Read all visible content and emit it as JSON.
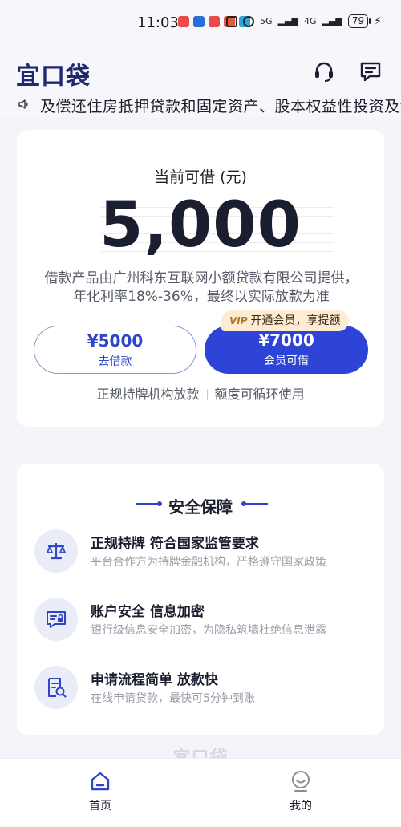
{
  "status_bar": {
    "time": "11:03",
    "network": "5G",
    "network2": "4G",
    "battery": "79"
  },
  "header": {
    "logo": "宜口袋",
    "icons": [
      "headset-icon",
      "message-icon"
    ]
  },
  "notice": {
    "text": "及偿还住房抵押贷款和固定资产、股本权益性投资及流动资金"
  },
  "loan": {
    "title": "当前可借 (元)",
    "amount": "5,000",
    "description": "借款产品由广州科东互联网小额贷款有限公司提供，年化利率18%-36%，最终以实际放款为准",
    "borrow_button": {
      "amount": "¥5000",
      "label": "去借款"
    },
    "member_button": {
      "amount": "¥7000",
      "label": "会员可借"
    },
    "vip_tag": {
      "badge": "VIP",
      "text": "开通会员，享提额"
    },
    "features": [
      "正规持牌机构放款",
      "额度可循环使用"
    ]
  },
  "security": {
    "title": "安全保障",
    "items": [
      {
        "icon": "scale-icon",
        "title": "正规持牌 符合国家监管要求",
        "desc": "平台合作方为持牌金融机构，严格遵守国家政策"
      },
      {
        "icon": "account-lock-icon",
        "title": "账户安全 信息加密",
        "desc": "银行级信息安全加密，为隐私筑墙杜绝信息泄露"
      },
      {
        "icon": "document-search-icon",
        "title": "申请流程简单 放款快",
        "desc": "在线申请贷款，最快可5分钟到账"
      }
    ]
  },
  "footer_logo": "宜口袋",
  "tabbar": {
    "home": "首页",
    "mine": "我的"
  },
  "colors": {
    "primary": "#2e44d6",
    "brand_dark": "#1f2a6e",
    "vip_tag_bg": "#fdebd3"
  }
}
